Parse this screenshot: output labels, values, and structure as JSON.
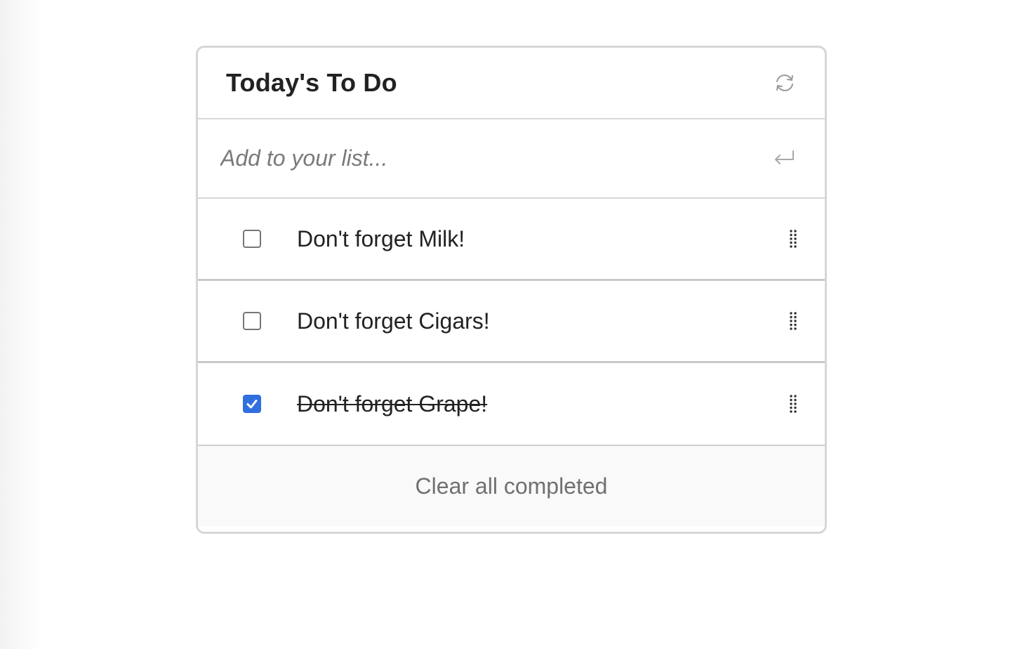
{
  "header": {
    "title": "Today's To Do",
    "refresh_icon": "refresh-icon"
  },
  "add": {
    "placeholder": "Add to your list...",
    "value": "",
    "submit_icon": "enter-return-icon"
  },
  "items": [
    {
      "label": "Don't forget Milk!",
      "completed": false
    },
    {
      "label": "Don't forget Cigars!",
      "completed": false
    },
    {
      "label": "Don't forget Grape!",
      "completed": true
    }
  ],
  "footer": {
    "clear_label": "Clear all completed"
  },
  "colors": {
    "checkbox_checked": "#2f6fdf",
    "border": "#d6d6d6",
    "footer_bg": "#f9f9f9"
  }
}
